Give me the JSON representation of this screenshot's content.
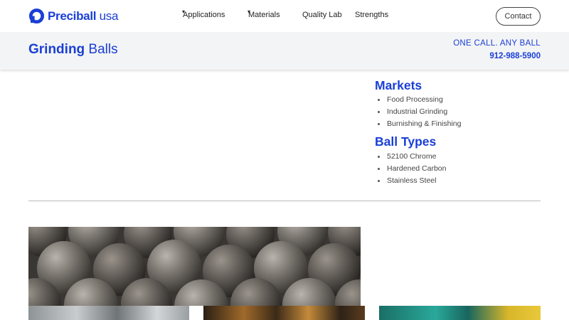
{
  "header": {
    "logo": {
      "brand": "Preciball",
      "suffix": " usa"
    },
    "nav": [
      {
        "label": "Applications",
        "has_dropdown": true
      },
      {
        "label": "Materials",
        "has_dropdown": true
      },
      {
        "label": "Quality Lab",
        "has_dropdown": false
      },
      {
        "label": "Strengths",
        "has_dropdown": false
      }
    ],
    "contact_label": "Contact"
  },
  "title_band": {
    "title_bold": "Grinding",
    "title_light": " Balls",
    "tagline": "ONE CALL. ANY BALL",
    "phone": "912-988-5900"
  },
  "markets": {
    "heading": "Markets",
    "items": [
      "Food Processing",
      "Industrial Grinding",
      "Burnishing & Finishing"
    ]
  },
  "ball_types": {
    "heading": "Ball Types",
    "items": [
      "52100 Chrome",
      "Hardened Carbon",
      "Stainless Steel"
    ]
  },
  "colors": {
    "brand_blue": "#1a3fd6",
    "band_bg": "#f3f4f5"
  },
  "icons": {
    "logo": "preciball-logo-icon",
    "dropdown": "dropdown-caret-icon"
  }
}
